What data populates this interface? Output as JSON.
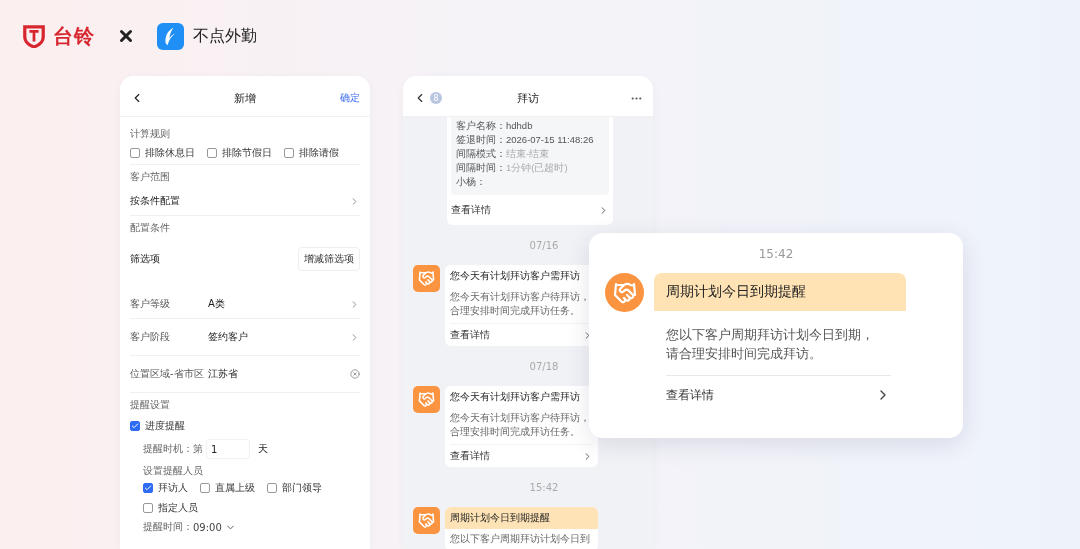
{
  "header": {
    "brand_left": "台铃",
    "brand_right": "不点外勤"
  },
  "form": {
    "title": "新增",
    "confirm": "确定",
    "calc_rule": {
      "label": "计算规则",
      "options": [
        {
          "label": "排除休息日",
          "checked": false
        },
        {
          "label": "排除节假日",
          "checked": false
        },
        {
          "label": "排除请假",
          "checked": false
        }
      ]
    },
    "customer_scope": {
      "label": "客户范围",
      "value": "按条件配置"
    },
    "config": {
      "label": "配置条件",
      "filter_label": "筛选项",
      "filter_button": "增减筛选项",
      "conditions": [
        {
          "label": "客户等级",
          "value": "A类",
          "kind": "chevron"
        },
        {
          "label": "客户阶段",
          "value": "签约客户",
          "kind": "chevron"
        },
        {
          "label": "位置区域-省市区",
          "value": "江苏省",
          "kind": "clear"
        }
      ]
    },
    "reminder": {
      "label": "提醒设置",
      "progress": {
        "label": "进度提醒",
        "checked": true
      },
      "timing_label": "提醒时机：第",
      "timing_value": "1",
      "timing_unit": "天",
      "people_label": "设置提醒人员",
      "people": [
        {
          "label": "拜访人",
          "checked": true
        },
        {
          "label": "直属上级",
          "checked": false
        },
        {
          "label": "部门领导",
          "checked": false
        },
        {
          "label": "指定人员",
          "checked": false
        }
      ],
      "time_label": "提醒时间：",
      "time_value": "09:00"
    }
  },
  "chat": {
    "title": "拜访",
    "badge": "8",
    "messages": [
      {
        "kind": "info",
        "lines": [
          {
            "label": "客户名称：",
            "value": "hdhdb",
            "muted": false
          },
          {
            "label": "签退时间：",
            "value": "2026-07-15 11:48:26",
            "muted": false
          },
          {
            "label": "间隔模式：",
            "value": "结束-结束",
            "muted": true
          },
          {
            "label": "间隔时间：",
            "value": "1分钟(已超时)",
            "muted": true
          },
          {
            "label": "小杨："
          }
        ],
        "link": "查看详情"
      },
      {
        "kind": "notice",
        "date": "07/16",
        "title": "您今天有计划拜访客户需拜访",
        "highlight": false,
        "body": "您今天有计划拜访客户待拜访，合理安排时间完成拜访任务。",
        "link": "查看详情"
      },
      {
        "kind": "notice",
        "date": "07/18",
        "title": "您今天有计划拜访客户需拜访",
        "highlight": false,
        "body": "您今天有计划拜访客户待拜访，合理安排时间完成拜访任务。",
        "link": "查看详情"
      },
      {
        "kind": "notice",
        "date": "15:42",
        "title": "周期计划今日到期提醒",
        "highlight": true,
        "body": "您以下客户周期拜访计划今日到"
      }
    ]
  },
  "popup": {
    "time": "15:42",
    "title": "周期计划今日到期提醒",
    "highlight": true,
    "body": "您以下客户周期拜访计划今日到期，请合理安排时间完成拜访。",
    "link": "查看详情"
  }
}
